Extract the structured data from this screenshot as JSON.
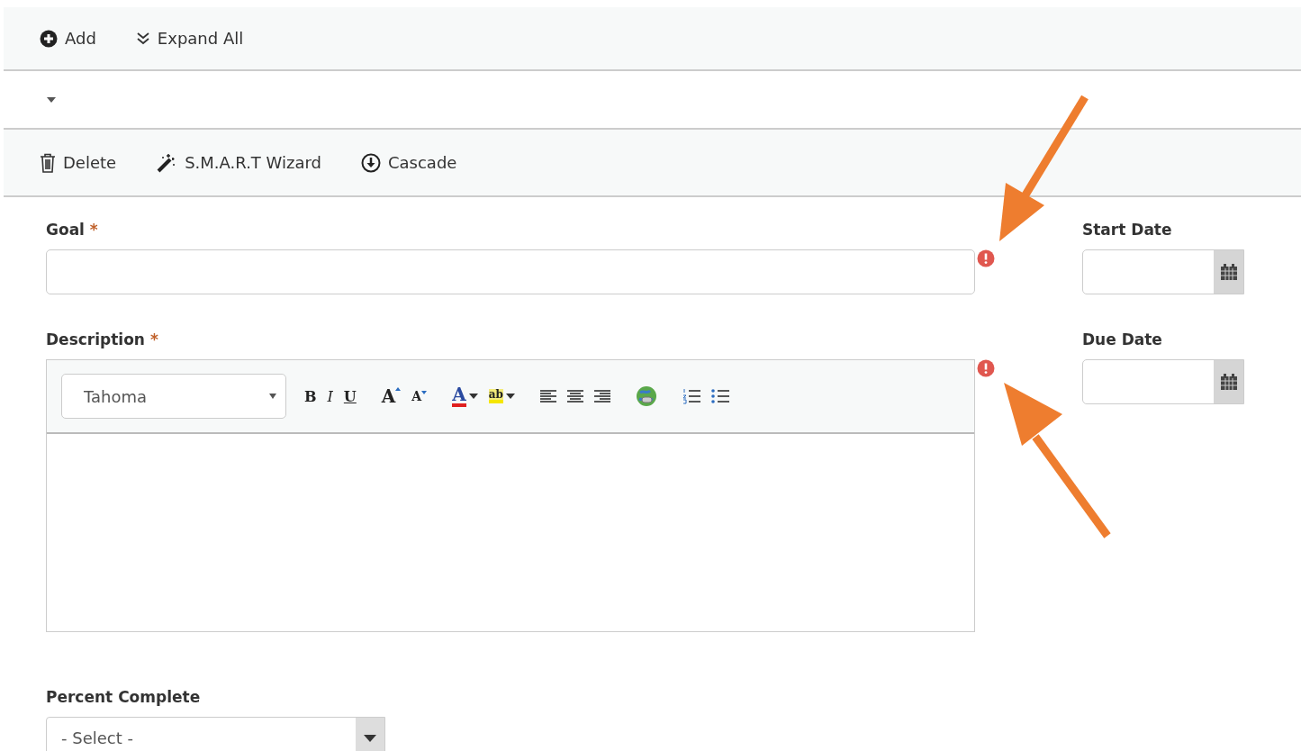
{
  "main_toolbar": [
    {
      "kind": "add",
      "label": "Add"
    },
    {
      "kind": "expand",
      "label": "Expand All"
    }
  ],
  "item_toolbar": [
    {
      "kind": "delete",
      "label": "Delete"
    },
    {
      "kind": "wizard",
      "label": "S.M.A.R.T Wizard"
    },
    {
      "kind": "cascade",
      "label": "Cascade"
    }
  ],
  "goal": {
    "label": "Goal",
    "required_mark": "*",
    "error": true
  },
  "description": {
    "label": "Description",
    "required_mark": "*",
    "error": true,
    "font": "Tahoma",
    "tools": [
      {
        "kind": "bold",
        "glyph": "B"
      },
      {
        "kind": "italic",
        "glyph": "I"
      },
      {
        "kind": "underline",
        "glyph": "U"
      },
      {
        "kind": "grow",
        "glyph": "A"
      },
      {
        "kind": "shrink",
        "glyph": "A"
      },
      {
        "kind": "color",
        "glyph": "A"
      },
      {
        "kind": "highlight",
        "glyph": "ab"
      },
      {
        "kind": "align-left"
      },
      {
        "kind": "align-center"
      },
      {
        "kind": "align-right"
      },
      {
        "kind": "link"
      },
      {
        "kind": "ordered-list"
      },
      {
        "kind": "bullet-list"
      }
    ]
  },
  "start_date": {
    "label": "Start Date"
  },
  "due_date": {
    "label": "Due Date"
  },
  "percent_complete": {
    "label": "Percent Complete",
    "value": "- Select -"
  }
}
